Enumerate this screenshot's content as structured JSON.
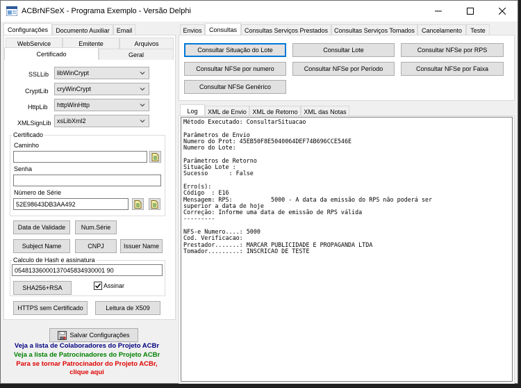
{
  "window": {
    "title": "ACBrNFSeX - Programa Exemplo - Versão Delphi"
  },
  "left": {
    "tabs": [
      "Configurações",
      "Documento Auxiliar",
      "Email"
    ],
    "subtabs_row1": [
      "WebService",
      "Emitente",
      "Arquivos"
    ],
    "subtabs_row2": [
      "Certificado",
      "Geral"
    ],
    "ssllib": {
      "label": "SSLLib",
      "value": "libWinCrypt"
    },
    "cryptlib": {
      "label": "CryptLib",
      "value": "cryWinCrypt"
    },
    "httplib": {
      "label": "HttpLib",
      "value": "httpWinHttp"
    },
    "xmlsignlib": {
      "label": "XMLSignLib",
      "value": "xsLibXml2"
    },
    "cert_group": "Certificado",
    "caminho_label": "Caminho",
    "caminho_value": "",
    "senha_label": "Senha",
    "senha_value": "",
    "serie_label": "Número de Série",
    "serie_value": "52E98643DB3AA492",
    "buttons": {
      "data_validade": "Data de Validade",
      "num_serie": "Num.Série",
      "subject_name": "Subject Name",
      "cnpj": "CNPJ",
      "issuer_name": "Issuer Name"
    },
    "hash_group": "Calculo de Hash e assinatura",
    "hash_value": "05481336000137045834930001 90",
    "sha_button": "SHA256+RSA",
    "assinar_label": "Assinar",
    "assinar_checked": true,
    "https_button": "HTTPS sem Certificado",
    "x509_button": "Leitura de X509",
    "salvar_button": "Salvar Configurações",
    "link_colaboradores": "Veja a lista de Colaboradores do Projeto ACBr",
    "link_patrocinadores": "Veja a lista de Patrocinadores do Projeto ACBr",
    "link_patrocinador_1": "Para se tornar Patrocinador do Projeto ACBr,",
    "link_patrocinador_2": "clique aqui",
    "colors": {
      "colaboradores": "#000080",
      "patrocinadores": "#008000",
      "patrocinador": "#e00000"
    }
  },
  "right": {
    "tabs": [
      "Envios",
      "Consultas",
      "Consultas Serviços Prestados",
      "Consultas Serviços Tomados",
      "Cancelamento",
      "Teste"
    ],
    "buttons": {
      "sit_lote": "Consultar Situação do Lote",
      "lote": "Consultar Lote",
      "nfse_rps": "Consultar NFSe por RPS",
      "nfse_numero": "Consultar NFSe por numero",
      "nfse_periodo": "Consultar NFSe por Período",
      "nfse_faixa": "Consultar NFSe por Faixa",
      "nfse_generico": "Consultar NFSe Genérico"
    },
    "log_tabs": [
      "Log",
      "XML de Envio",
      "XML de Retorno",
      "XML das Notas"
    ],
    "log_lines": [
      "Método Executado: ConsultarSituacao",
      "",
      "Parâmetros de Envio",
      "Numero do Prot: 45EB50F8E5040064DEF74B696CCE546E",
      "Numero do Lote:",
      "",
      "Parâmetros de Retorno",
      "Situação Lote :",
      "Sucesso      : False",
      "",
      "Erro(s):",
      "Código  : E16",
      "Mensagem: RPS:           5000 - A data da emissão do RPS não poderá ser",
      "superior a data de hoje",
      "Correção: Informe uma data de emissão de RPS válida",
      "---------",
      "",
      "NFS-e Numero....: 5000",
      "Cod. Verificacao:",
      "Prestador.......: MARCAR PUBLICIDADE E PROPAGANDA LTDA",
      "Tomador.........: INSCRICAO DE TESTE"
    ]
  }
}
